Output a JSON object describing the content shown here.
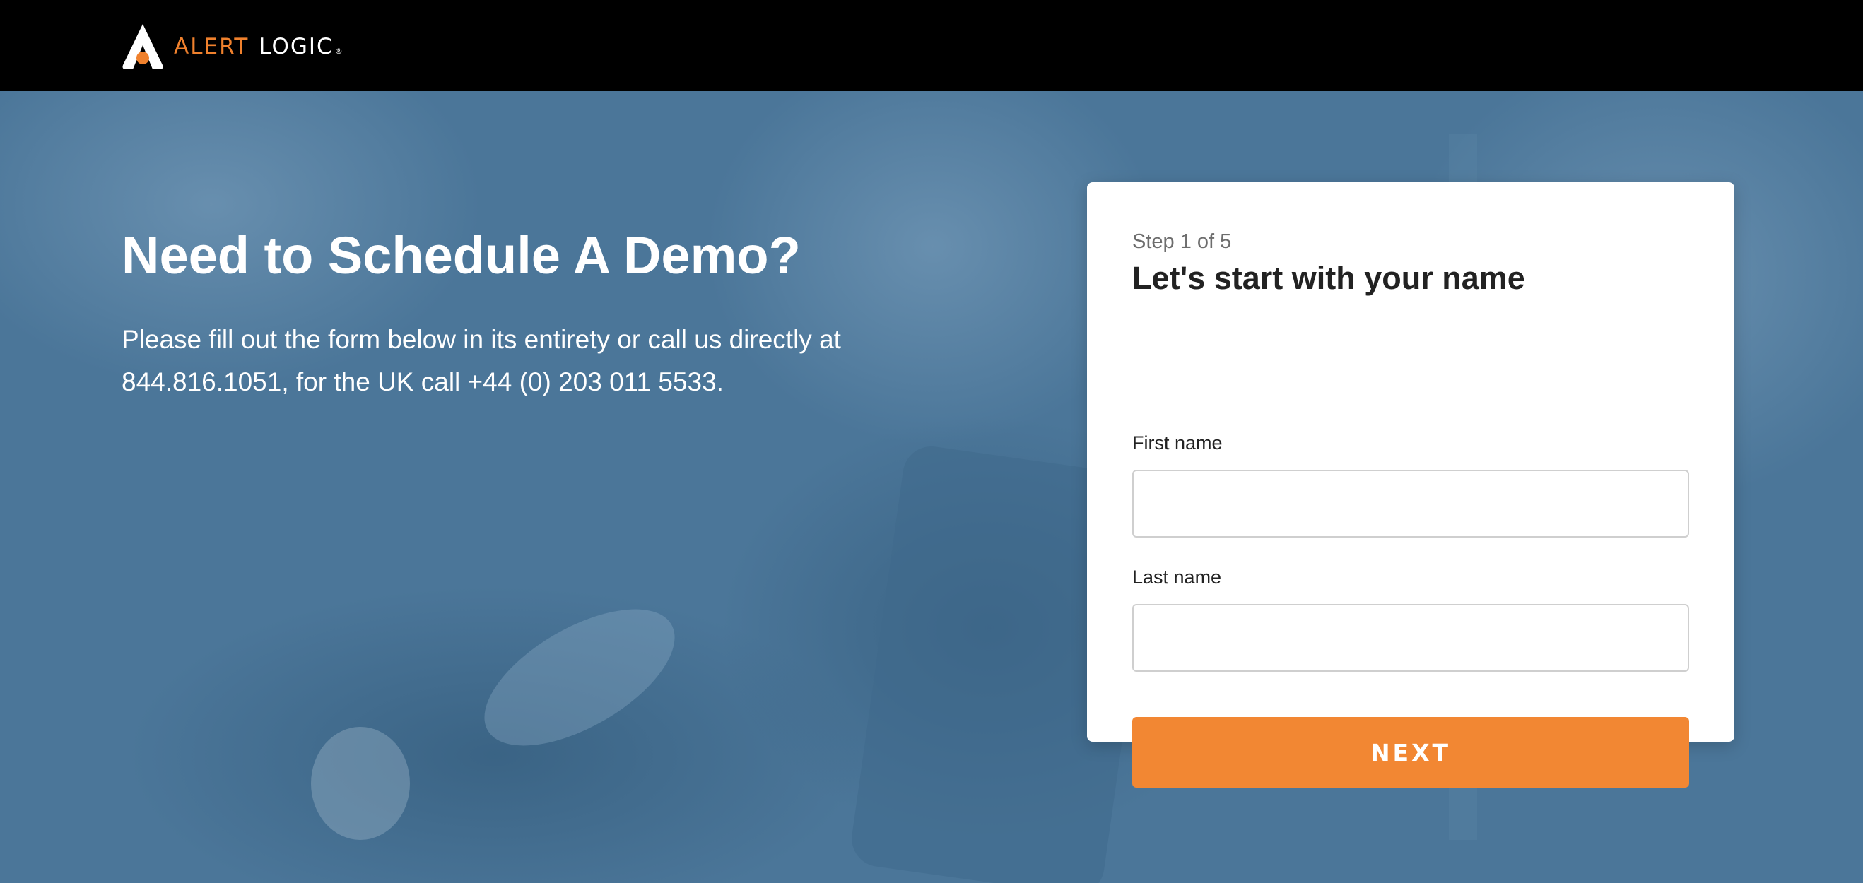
{
  "header": {
    "logo": {
      "word1": "ALERT",
      "word2": "LOGIC",
      "reg": "®"
    },
    "brand_colors": {
      "orange": "#f0812d",
      "black": "#000000"
    }
  },
  "hero": {
    "headline": "Need to Schedule A Demo?",
    "intro": "Please fill out the form below in its entirety or call us directly at 844.816.1051, for the UK call +44 (0) 203 011 5533.",
    "background_tint": "#4b7699"
  },
  "form": {
    "step": "Step 1 of 5",
    "title": "Let's start with your name",
    "first_name_label": "First name",
    "first_name_value": "",
    "last_name_label": "Last name",
    "last_name_value": "",
    "next_label": "NEXT",
    "button_color": "#f28733"
  }
}
